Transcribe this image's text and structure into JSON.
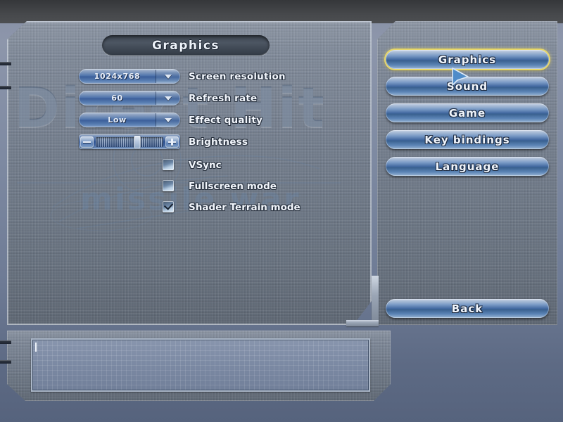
{
  "window": {
    "title": "Graphics",
    "watermark_main": "Direct Hit",
    "watermark_sub": "missile war"
  },
  "colors": {
    "accent_selected": "#e8d86a",
    "button_blue": "#40679f",
    "panel_metal": "#737d8c",
    "text_primary": "#f2f6fc",
    "background": "#7e8aa2"
  },
  "settings": {
    "dropdowns": [
      {
        "label": "Screen resolution",
        "value": "1024x768",
        "icon": "chevron-down-icon"
      },
      {
        "label": "Refresh rate",
        "value": "60",
        "icon": "chevron-down-icon"
      },
      {
        "label": "Effect quality",
        "value": "Low",
        "icon": "chevron-down-icon"
      }
    ],
    "slider": {
      "label": "Brightness",
      "percent": 61,
      "decrease_icon": "minus-icon",
      "increase_icon": "plus-icon"
    },
    "checkboxes": [
      {
        "label": "VSync",
        "checked": false
      },
      {
        "label": "Fullscreen mode",
        "checked": false
      },
      {
        "label": "Shader Terrain mode",
        "checked": true
      }
    ]
  },
  "nav": {
    "items": [
      {
        "label": "Graphics",
        "selected": true
      },
      {
        "label": "Sound",
        "selected": false
      },
      {
        "label": "Game",
        "selected": false
      },
      {
        "label": "Key bindings",
        "selected": false
      },
      {
        "label": "Language",
        "selected": false
      }
    ],
    "back_label": "Back"
  },
  "console": {
    "value": "",
    "placeholder": ""
  },
  "cursor": {
    "icon": "pointer-arrow-icon"
  }
}
